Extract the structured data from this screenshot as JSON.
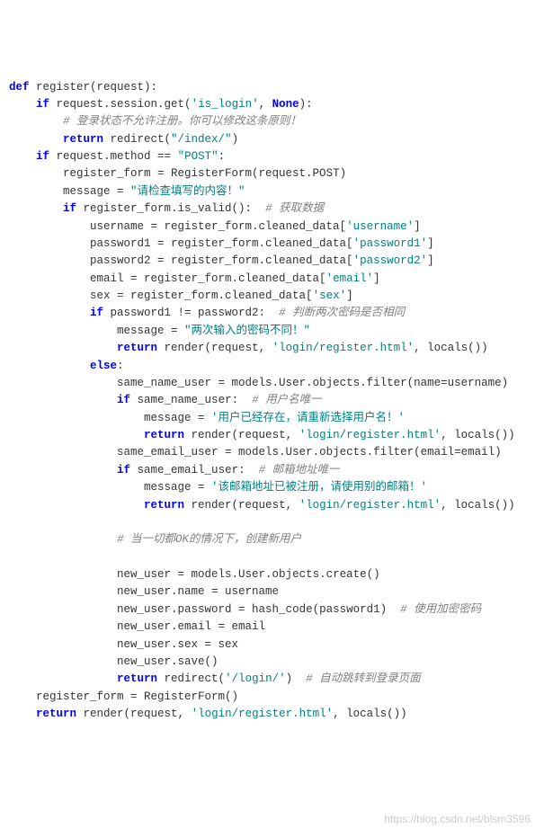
{
  "code": {
    "l1_def": "def",
    "l1_rest": " register(request):",
    "l2_if": "if",
    "l2_rest": " request.session.get(",
    "l2_s1": "'is_login'",
    "l2_mid": ", ",
    "l2_none": "None",
    "l2_end": "):",
    "l3": "# 登录状态不允许注册。你可以修改这条原则！",
    "l4_ret": "return",
    "l4_rest": " redirect(",
    "l4_s": "\"/index/\"",
    "l4_end": ")",
    "l5_if": "if",
    "l5_rest": " request.method == ",
    "l5_s": "\"POST\"",
    "l5_end": ":",
    "l6": "register_form = RegisterForm(request.POST)",
    "l7a": "message = ",
    "l7s": "\"请检查填写的内容！\"",
    "l8_if": "if",
    "l8_rest": " register_form.is_valid():  ",
    "l8_c": "# 获取数据",
    "l9a": "username = register_form.cleaned_data[",
    "l9s": "'username'",
    "l9e": "]",
    "l10a": "password1 = register_form.cleaned_data[",
    "l10s": "'password1'",
    "l10e": "]",
    "l11a": "password2 = register_form.cleaned_data[",
    "l11s": "'password2'",
    "l11e": "]",
    "l12a": "email = register_form.cleaned_data[",
    "l12s": "'email'",
    "l12e": "]",
    "l13a": "sex = register_form.cleaned_data[",
    "l13s": "'sex'",
    "l13e": "]",
    "l14_if": "if",
    "l14_rest": " password1 != password2:  ",
    "l14_c": "# 判断两次密码是否相同",
    "l15a": "message = ",
    "l15s": "\"两次输入的密码不同！\"",
    "l16_ret": "return",
    "l16_rest": " render(request, ",
    "l16s": "'login/register.html'",
    "l16e": ", locals())",
    "l17": "else",
    "l18a": "same_name_user = models.User.objects.filter(",
    "l18p": "name",
    "l18e": "=username)",
    "l19_if": "if",
    "l19_rest": " same_name_user:  ",
    "l19_c": "# 用户名唯一",
    "l20a": "message = ",
    "l20s": "'用户已经存在，请重新选择用户名！'",
    "l21_ret": "return",
    "l21_rest": " render(request, ",
    "l21s": "'login/register.html'",
    "l21e": ", locals())",
    "l22a": "same_email_user = models.User.objects.filter(",
    "l22p": "email",
    "l22e": "=email)",
    "l23_if": "if",
    "l23_rest": " same_email_user:  ",
    "l23_c": "# 邮箱地址唯一",
    "l24a": "message = ",
    "l24s": "'该邮箱地址已被注册，请使用别的邮箱！'",
    "l25_ret": "return",
    "l25_rest": " render(request, ",
    "l25s": "'login/register.html'",
    "l25e": ", locals())",
    "l26": "# 当一切都OK的情况下，创建新用户",
    "l27": "new_user = models.User.objects.create()",
    "l28": "new_user.name = username",
    "l29a": "new_user.password = hash_code(password1)  ",
    "l29c": "# 使用加密密码",
    "l30": "new_user.email = email",
    "l31": "new_user.sex = sex",
    "l32": "new_user.save()",
    "l33_ret": "return",
    "l33_rest": " redirect(",
    "l33s": "'/login/'",
    "l33e": ")  ",
    "l33c": "# 自动跳转到登录页面",
    "l34": "register_form = RegisterForm()",
    "l35_ret": "return",
    "l35_rest": " render(request, ",
    "l35s": "'login/register.html'",
    "l35e": ", locals())"
  },
  "watermark": "https://blog.csdn.net/blsm3596"
}
